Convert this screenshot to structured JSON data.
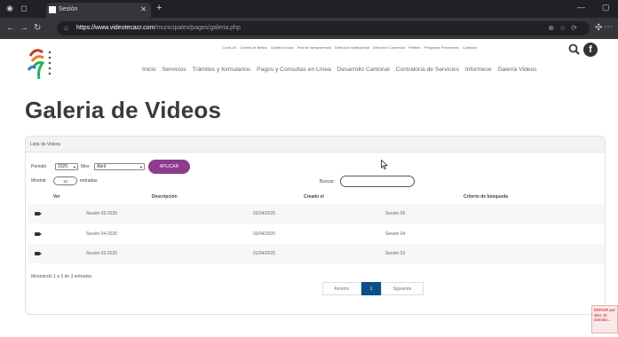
{
  "browser": {
    "tab_title": "Sesión",
    "url_host": "https://www.videotecacr.com",
    "url_path": "/municipales/pages/galeria.php"
  },
  "header": {
    "top_links": [
      "Covid-19",
      "Control de Bellos",
      "Gobierno local",
      "Red de transparencia",
      "Dirección Institucional",
      "Dirección Comercial",
      "Perfiles",
      "Preguntas Frecuentes",
      "Contacto"
    ],
    "nav": [
      "Inicio",
      "Servicios",
      "Trámites y formularios",
      "Pagos y Consultas en Línea",
      "Desarrollo Cantonal",
      "Contraloría de Servicios",
      "Informese",
      "Galería Videos"
    ],
    "facebook_letter": "f"
  },
  "page": {
    "title": "Galeria de Videos"
  },
  "panel": {
    "title": "Lista de Videos",
    "period_label": "Periodo",
    "period_value": "2025",
    "month_label": "Mes",
    "month_value": "Abril",
    "apply_label": "APLICAR",
    "show_label": "Mostrar",
    "show_value": "10",
    "entries_label": "entradas",
    "search_label": "Buscar:",
    "search_value": "",
    "columns": [
      "Ver",
      "Descripción",
      "Creado el",
      "Criterio de búsqueda"
    ],
    "rows": [
      {
        "description": "Sesión 05-2025",
        "created": "03/04/2025",
        "criteria": "Sesión 05"
      },
      {
        "description": "Sesión 04-2025",
        "created": "02/04/2025",
        "criteria": "Sesión 04"
      },
      {
        "description": "Sesión 03-2025",
        "created": "01/04/2025",
        "criteria": "Sesión 03"
      }
    ],
    "info": "Mostrando 1 a 3 de 3 entradas",
    "pagination": {
      "prev": "Anterior",
      "current": "1",
      "next": "Siguiente"
    }
  },
  "error_note": "ERROR por sitio: El dominio...",
  "colors": {
    "accent": "#8e3a8e",
    "pager_active": "#0d4f8b"
  }
}
